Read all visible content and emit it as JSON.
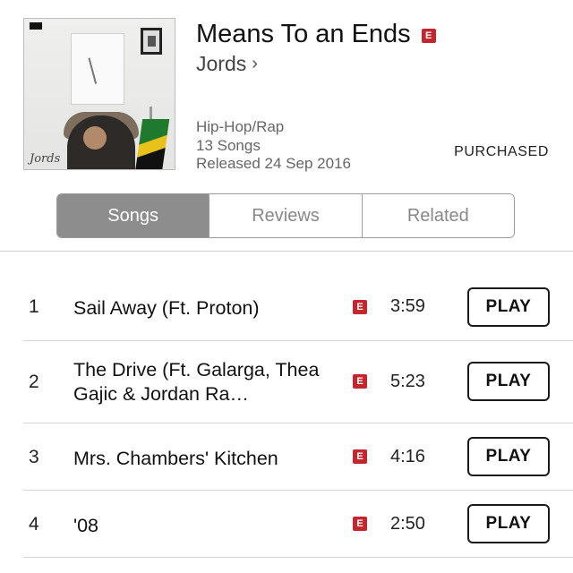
{
  "album": {
    "title": "Means To an Ends",
    "explicit_badge": "E",
    "artist": "Jords",
    "artist_chevron": "›",
    "genre": "Hip-Hop/Rap",
    "song_count": "13 Songs",
    "released": "Released 24 Sep 2016",
    "status": "PURCHASED",
    "cover_signature": "Jords"
  },
  "tabs": [
    {
      "label": "Songs",
      "active": true
    },
    {
      "label": "Reviews",
      "active": false
    },
    {
      "label": "Related",
      "active": false
    }
  ],
  "tracks": [
    {
      "number": "1",
      "title": "Sail Away (Ft. Proton)",
      "explicit": "E",
      "duration": "3:59",
      "action": "PLAY"
    },
    {
      "number": "2",
      "title": "The Drive (Ft. Galarga, Thea Gajic & Jordan Ra…",
      "explicit": "E",
      "duration": "5:23",
      "action": "PLAY"
    },
    {
      "number": "3",
      "title": "Mrs. Chambers' Kitchen",
      "explicit": "E",
      "duration": "4:16",
      "action": "PLAY"
    },
    {
      "number": "4",
      "title": "'08",
      "explicit": "E",
      "duration": "2:50",
      "action": "PLAY"
    }
  ],
  "colors": {
    "explicit": "#c4262e",
    "segment_active": "#8d8d8d"
  }
}
